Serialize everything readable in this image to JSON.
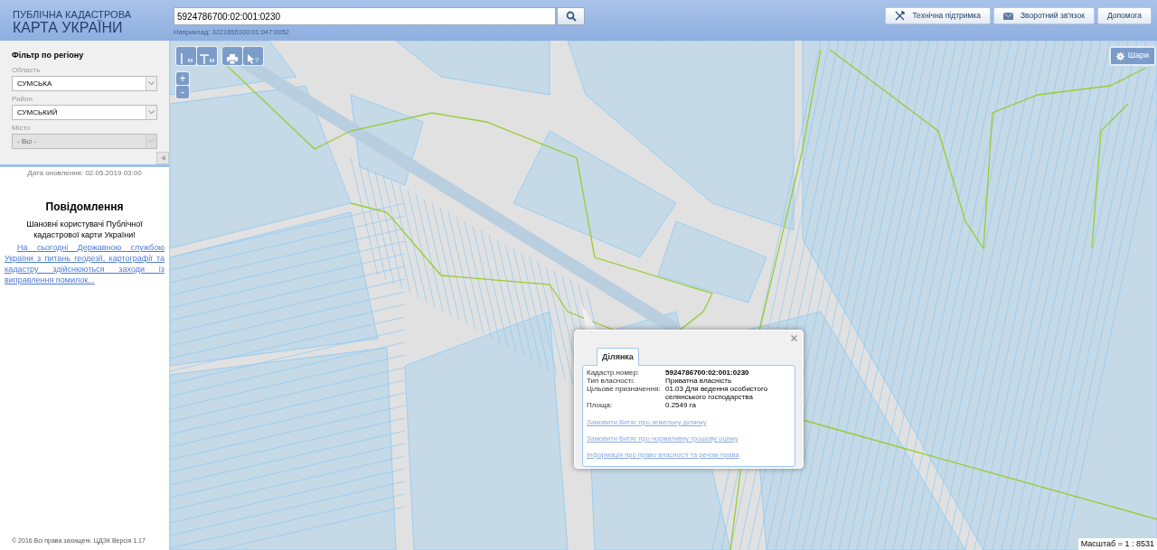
{
  "header": {
    "logo_line_1": "ПУБЛІЧНА КАДАСТРОВА",
    "logo_line_2": "КАРТА УКРАЇНИ",
    "search": {
      "value": "5924786700:02:001:0230",
      "hint": "Наприклад: 3221655100:01:047:0052"
    },
    "buttons": [
      {
        "kind": "support",
        "label": "Технічна підтримка"
      },
      {
        "kind": "feedback",
        "label": "Зворотний зв'язок"
      },
      {
        "kind": "help",
        "label": "Допомога"
      }
    ]
  },
  "filter": {
    "title": "Фільтр по регіону",
    "fields": [
      {
        "label": "Область",
        "value": "СУМСЬКА",
        "disabled": false
      },
      {
        "label": "Район",
        "value": "СУМСЬКИЙ",
        "disabled": false
      },
      {
        "label": "Місто",
        "value": "- Всі -",
        "disabled": true
      }
    ]
  },
  "update_date": "Дата оновлення: 02.05.2019 03:00",
  "notice": {
    "title": "Повідомлення",
    "greeting": "Шановні користувачі Публічної кадастрової карти України!",
    "link": "На сьогодні Державною службою України з питань геодезії, картографії та кадастру здійснюються заходи із виправлення помилок..."
  },
  "footer": "© 2016 Всі права захищені. ЦДЗК  Версія  1.17",
  "map_tools": [
    {
      "kind": "distance",
      "unit": "м"
    },
    {
      "kind": "area",
      "unit": "м"
    },
    {
      "kind": "print"
    },
    {
      "kind": "identify",
      "suffix": "?"
    }
  ],
  "zoom": {
    "in": "+",
    "out": "-"
  },
  "layers_button": "Шари",
  "scale": "Масштаб = 1 : 8531",
  "popup": {
    "tab": "Ділянка",
    "rows": [
      {
        "label": "Кадастр.номер:",
        "value": "5924786700:02:001:0230",
        "bold": true
      },
      {
        "label": "Тип власності:",
        "value": "Приватна власність",
        "bold": false
      },
      {
        "label": "Цільове призначення:",
        "value": "01.03 Для ведення особистого селянського господарства",
        "bold": false
      },
      {
        "label": "Площа:",
        "value": "0.2549 га",
        "bold": false
      }
    ],
    "links": [
      "Замовити Витяг про земельну ділянку",
      "Замовити Витяг про нормативну грошову оцінку",
      "Інформація про право власності та речові права"
    ]
  }
}
